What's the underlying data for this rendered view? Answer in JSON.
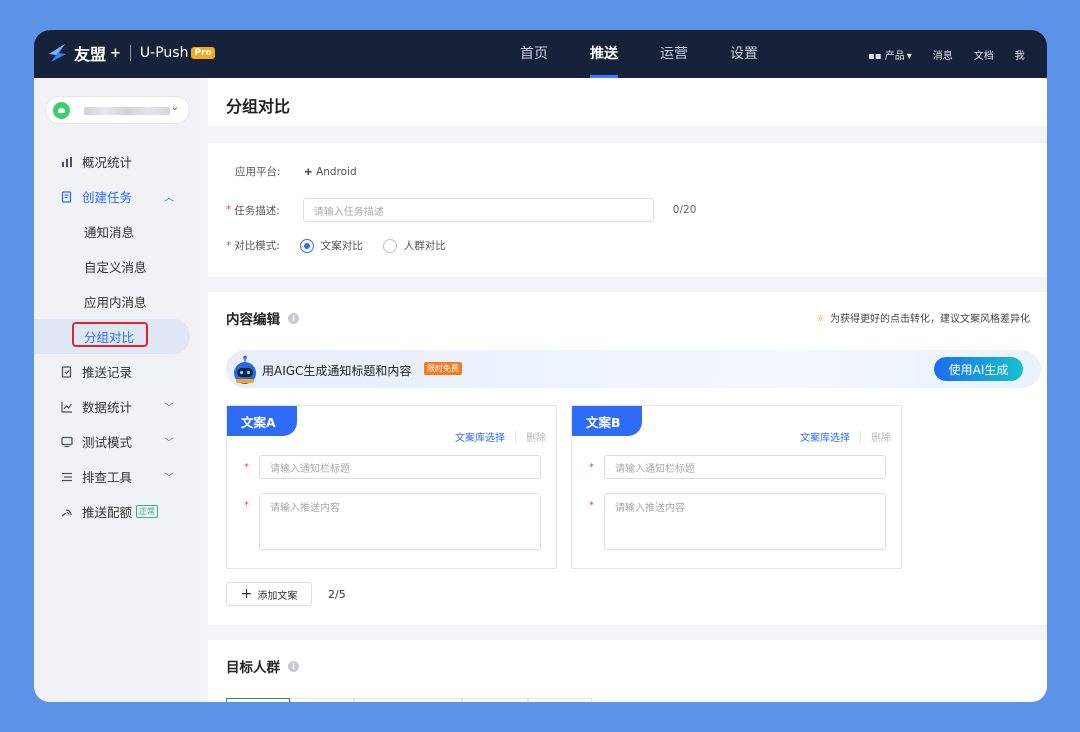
{
  "header": {
    "brand": "友盟",
    "brand_plus": "+",
    "product": "U-Push",
    "pro_badge": "Pro",
    "nav": [
      {
        "label": "首页",
        "active": false
      },
      {
        "label": "推送",
        "active": true
      },
      {
        "label": "运营",
        "active": false
      },
      {
        "label": "设置",
        "active": false
      }
    ],
    "right": {
      "products": "产品",
      "messages": "消息",
      "docs": "文档",
      "me": "我"
    }
  },
  "sidebar": {
    "items": [
      {
        "label": "概况统计",
        "icon": "chart-icon"
      },
      {
        "label": "创建任务",
        "icon": "task-icon"
      },
      {
        "label": "通知消息"
      },
      {
        "label": "自定义消息"
      },
      {
        "label": "应用内消息"
      },
      {
        "label": "分组对比"
      },
      {
        "label": "推送记录",
        "icon": "record-icon"
      },
      {
        "label": "数据统计",
        "icon": "line-chart-icon"
      },
      {
        "label": "测试模式",
        "icon": "monitor-icon"
      },
      {
        "label": "排查工具",
        "icon": "tools-icon"
      },
      {
        "label": "推送配额",
        "icon": "quota-icon",
        "badge": "正常"
      }
    ]
  },
  "page": {
    "title": "分组对比"
  },
  "form": {
    "platform_label": "应用平台:",
    "platform_value": "Android",
    "task_desc_label": "任务描述:",
    "task_desc_placeholder": "请输入任务描述",
    "task_desc_count": "0/20",
    "mode_label": "对比模式:",
    "modes": [
      {
        "label": "文案对比",
        "checked": true
      },
      {
        "label": "人群对比",
        "checked": false
      }
    ]
  },
  "content": {
    "title": "内容编辑",
    "tip": "为获得更好的点击转化，建议文案风格差异化",
    "ai_text": "用AIGC生成通知标题和内容",
    "ai_badge": "限时免费",
    "ai_button": "使用AI生成",
    "cards": [
      {
        "tag": "文案A",
        "lib": "文案库选择",
        "delete": "删除",
        "title_placeholder": "请输入通知栏标题",
        "body_placeholder": "请输入推送内容"
      },
      {
        "tag": "文案B",
        "lib": "文案库选择",
        "delete": "删除",
        "title_placeholder": "请输入通知栏标题",
        "body_placeholder": "请输入推送内容"
      }
    ],
    "add_button": "添加文案",
    "add_count": "2/5"
  },
  "target": {
    "title": "目标人群"
  },
  "colors": {
    "accent": "#2f6cf6",
    "topbar": "#15223a",
    "frame": "#5b93e6"
  }
}
